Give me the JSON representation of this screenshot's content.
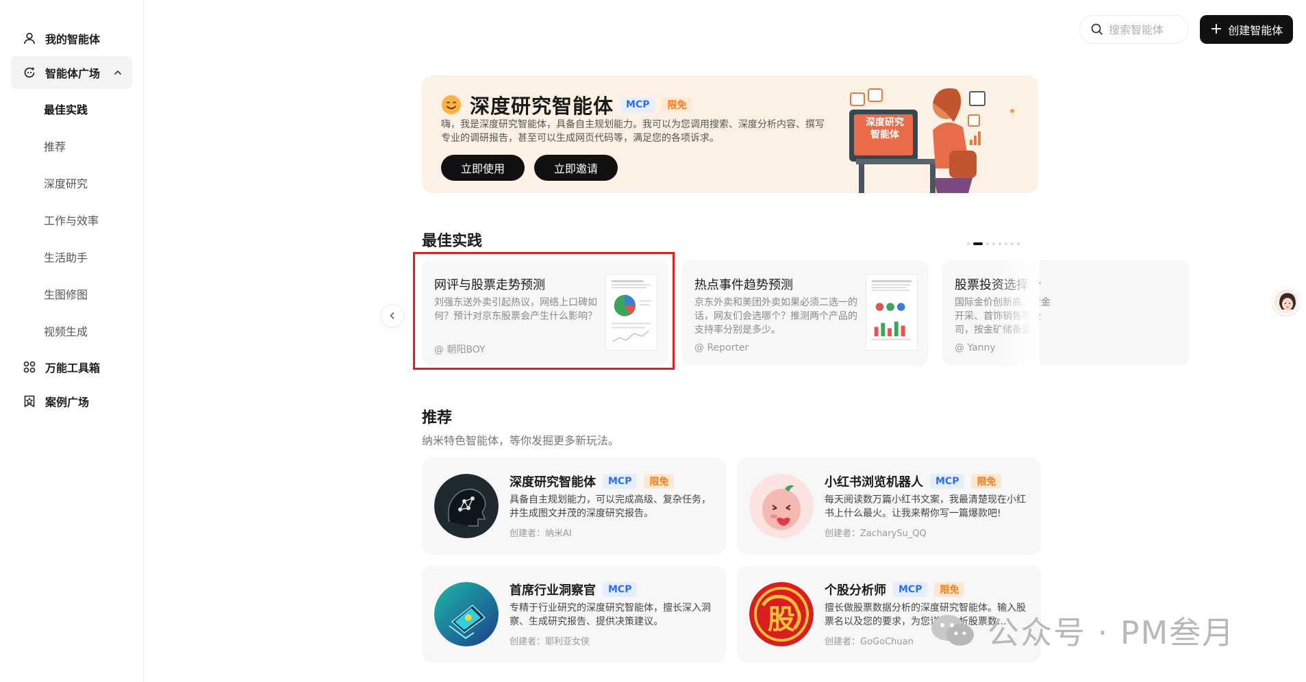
{
  "sidebar": {
    "items": [
      {
        "label": "我的智能体",
        "icon": "user-icon"
      },
      {
        "label": "智能体广场",
        "icon": "plaza-icon",
        "expanded": true,
        "children": [
          "最佳实践",
          "推荐",
          "深度研究",
          "工作与效率",
          "生活助手",
          "生图修图",
          "视频生成"
        ],
        "active_child": "最佳实践"
      },
      {
        "label": "万能工具箱",
        "icon": "toolbox-icon"
      },
      {
        "label": "案例广场",
        "icon": "case-icon"
      }
    ]
  },
  "topbar": {
    "search_placeholder": "搜索智能体",
    "create_label": "创建智能体"
  },
  "banner": {
    "title": "深度研究智能体",
    "tag_mcp": "MCP",
    "tag_free": "限免",
    "description": "嗨，我是深度研究智能体，具备自主规划能力。我可以为您调用搜索、深度分析内容、撰写专业的调研报告，甚至可以生成网页代码等，满足您的各项诉求。",
    "btn_use": "立即使用",
    "btn_invite": "立即邀请",
    "illustration_text": [
      "深度研究",
      "智能体"
    ]
  },
  "best_practice": {
    "title": "最佳实践",
    "pager": {
      "total": 8,
      "active": 1
    },
    "cards": [
      {
        "title": "网评与股票走势预测",
        "desc": "刘强东送外卖引起热议，网络上口碑如何？预计对京东股票会产生什么影响？",
        "author": "@ 朝阳BOY"
      },
      {
        "title": "热点事件趋势预测",
        "desc": "京东外卖和美团外卖如果必须二选一的话，网友们会选哪个？推测两个产品的支持率分别是多少。",
        "author": "@ Reporter"
      },
      {
        "title": "股票投资选择分",
        "desc": "国际金价创新高，黄金开采、首饰销售等公司，按金矿储备量",
        "author": "@ Yanny"
      }
    ]
  },
  "recommend": {
    "title": "推荐",
    "subtitle": "纳米特色智能体，等你发掘更多新玩法。",
    "creator_prefix": "创建者：",
    "cards": [
      {
        "title": "深度研究智能体",
        "mcp": "MCP",
        "free": "限免",
        "desc": "具备自主规划能力，可以完成高级、复杂任务，并生成图文并茂的深度研究报告。",
        "creator": "纳米AI",
        "avatar": "brain-avatar"
      },
      {
        "title": "小红书浏览机器人",
        "mcp": "MCP",
        "free": "限免",
        "desc": "每天阅读数万篇小红书文案，我最清楚现在小红书上什么最火。让我来帮你写一篇爆款吧!",
        "creator": "ZacharySu_QQ",
        "avatar": "cute-face-avatar"
      },
      {
        "title": "首席行业洞察官",
        "mcp": "MCP",
        "free": "",
        "desc": "专精于行业研究的深度研究智能体，擅长深入洞察、生成研究报告、提供决策建议。",
        "creator": "耶利亚女侠",
        "avatar": "laptop-avatar"
      },
      {
        "title": "个股分析师",
        "mcp": "MCP",
        "free": "限免",
        "desc": "擅长做股票数据分析的深度研究智能体。输入股票名以及您的要求，为您详细分析股票数...",
        "creator": "GoGoChuan",
        "avatar": "dragon-avatar",
        "avatar_char": "股"
      }
    ]
  },
  "watermark": "公众号 · PM叁月",
  "colors": {
    "accent_red": "#e02020",
    "mcp_blue": "#2d6df6",
    "free_orange": "#ff7a1a",
    "banner_bg": "#fcf1e4"
  }
}
